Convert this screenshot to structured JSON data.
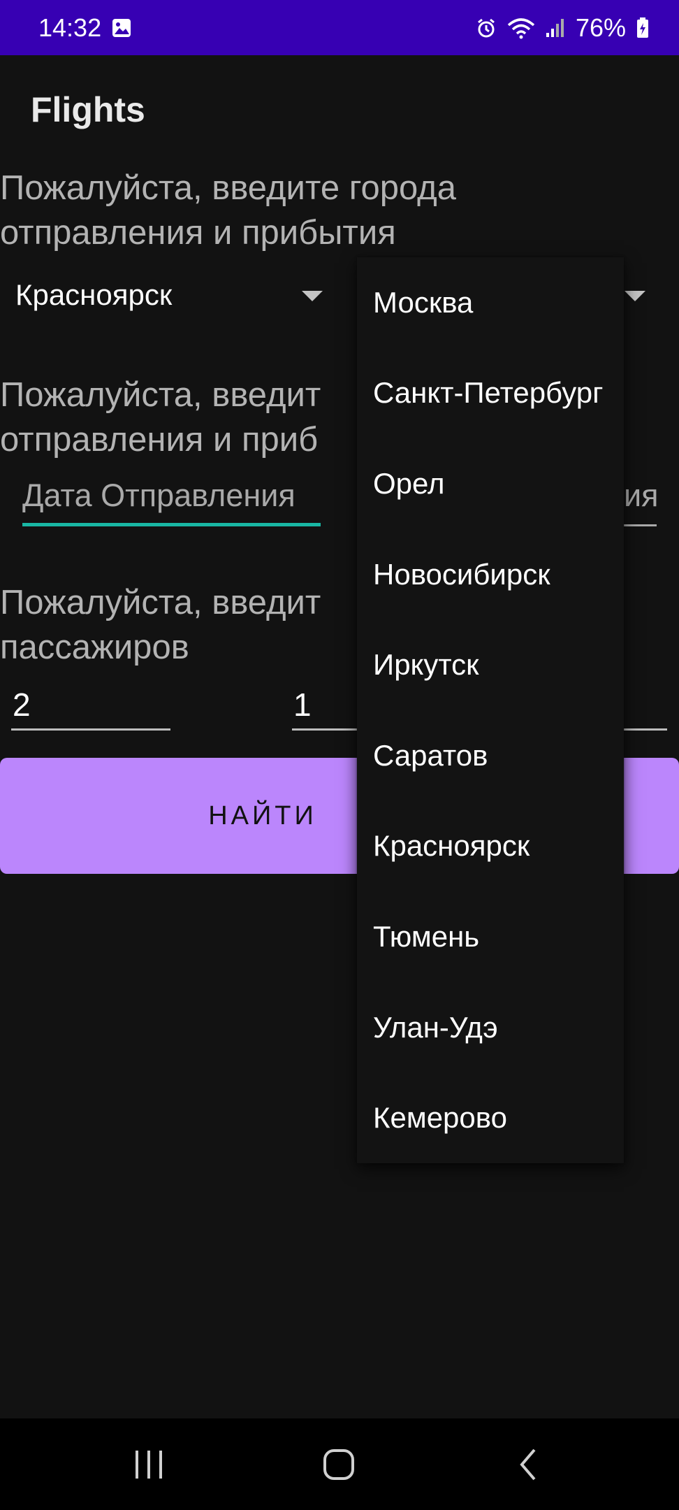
{
  "status_bar": {
    "time": "14:32",
    "battery": "76%",
    "icons": [
      "image-icon",
      "alarm-icon",
      "wifi-icon",
      "signal-icon",
      "battery-icon"
    ]
  },
  "app": {
    "title": "Flights"
  },
  "cities_prompt": {
    "line1": "Пожалуйста, введите города",
    "line2": "отправления и прибытия"
  },
  "from_city": {
    "value": "Красноярск"
  },
  "dates_prompt": {
    "line1": "Пожалуйста, введит",
    "line2": "отправления и приб"
  },
  "departure_date": {
    "placeholder": "Дата Отправления"
  },
  "return_date": {
    "placeholder_fragment": "ия"
  },
  "passengers_prompt": {
    "line1": "Пожалуйста, введит",
    "line2": "пассажиров"
  },
  "passengers": {
    "adults": "2",
    "children": "1"
  },
  "search_button": {
    "label_visible": "НАЙТИ"
  },
  "dropdown": {
    "items": [
      "Москва",
      "Санкт-Петербург",
      "Орел",
      "Новосибирск",
      "Иркутск",
      "Саратов",
      "Красноярск",
      "Тюмень",
      "Улан-Удэ",
      "Кемерово"
    ]
  },
  "colors": {
    "status_bar": "#3700b3",
    "background": "#121212",
    "accent_button": "#bb86fc",
    "focus_underline": "#19b7a4"
  }
}
